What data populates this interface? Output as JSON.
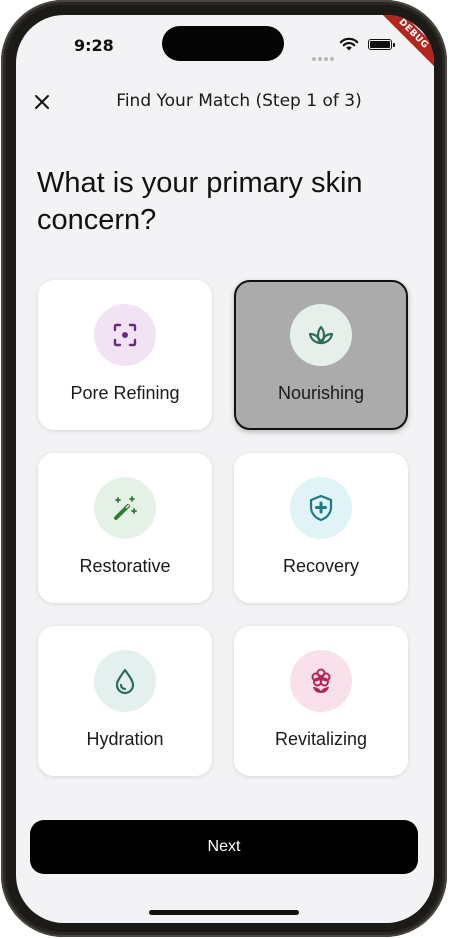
{
  "status": {
    "time": "9:28",
    "debug_label": "DEBUG"
  },
  "header": {
    "title": "Find Your Match (Step 1 of 3)"
  },
  "question": "What is your primary skin concern?",
  "options": [
    {
      "label": "Pore Refining",
      "icon": "focus-scan-icon",
      "selected": false,
      "circle_color": "#f1e3f3",
      "icon_color": "#6a2c83"
    },
    {
      "label": "Nourishing",
      "icon": "sprout-leaf-icon",
      "selected": true,
      "circle_color": "#e6efe9",
      "icon_color": "#2f6b5c"
    },
    {
      "label": "Restorative",
      "icon": "magic-wand-icon",
      "selected": false,
      "circle_color": "#e5f1e6",
      "icon_color": "#2e7d32"
    },
    {
      "label": "Recovery",
      "icon": "shield-plus-icon",
      "selected": false,
      "circle_color": "#e0f3f6",
      "icon_color": "#1d7a86"
    },
    {
      "label": "Hydration",
      "icon": "water-drop-icon",
      "selected": false,
      "circle_color": "#e3f0ee",
      "icon_color": "#2c6b62"
    },
    {
      "label": "Revitalizing",
      "icon": "flower-icon",
      "selected": false,
      "circle_color": "#f8e1ea",
      "icon_color": "#b0285a"
    }
  ],
  "actions": {
    "next_label": "Next"
  }
}
